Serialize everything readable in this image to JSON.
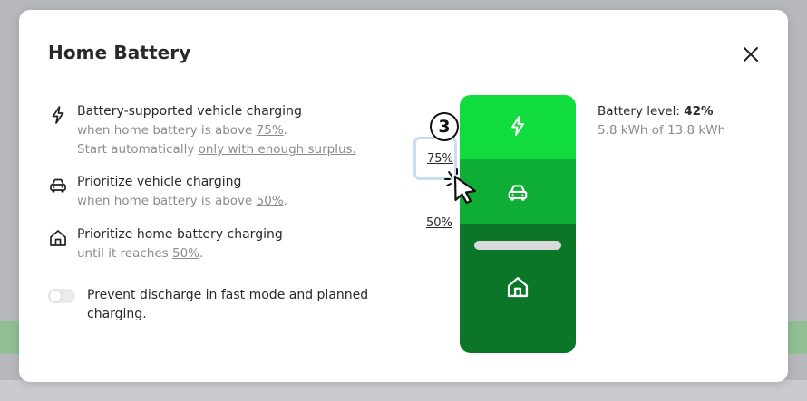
{
  "modal": {
    "title": "Home Battery"
  },
  "options": [
    {
      "icon": "lightning-icon",
      "title": "Battery-supported vehicle charging",
      "sub1_prefix": "when home battery is above ",
      "sub1_link": "75%",
      "sub1_suffix": ".",
      "sub2_prefix": "Start automatically ",
      "sub2_link": "only with enough surplus."
    },
    {
      "icon": "car-icon",
      "title": "Prioritize vehicle charging",
      "sub1_prefix": "when home battery is above ",
      "sub1_link": "50%",
      "sub1_suffix": "."
    },
    {
      "icon": "house-icon",
      "title": "Prioritize home battery charging",
      "sub1_prefix": "until it reaches ",
      "sub1_link": "50%",
      "sub1_suffix": "."
    }
  ],
  "toggle": {
    "label": "Prevent discharge in fast mode and planned charging.",
    "checked": false
  },
  "battery_visual": {
    "threshold_upper_label": "75%",
    "threshold_lower_label": "50%",
    "step_badge": "3",
    "colors": {
      "top": "#11dc3e",
      "middle": "#0ead35",
      "bottom": "#0b7627",
      "focus_ring": "#c6ddf4"
    }
  },
  "battery_info": {
    "level_label": "Battery level: ",
    "level_value": "42%",
    "energy": "5.8 kWh of 13.8 kWh"
  }
}
